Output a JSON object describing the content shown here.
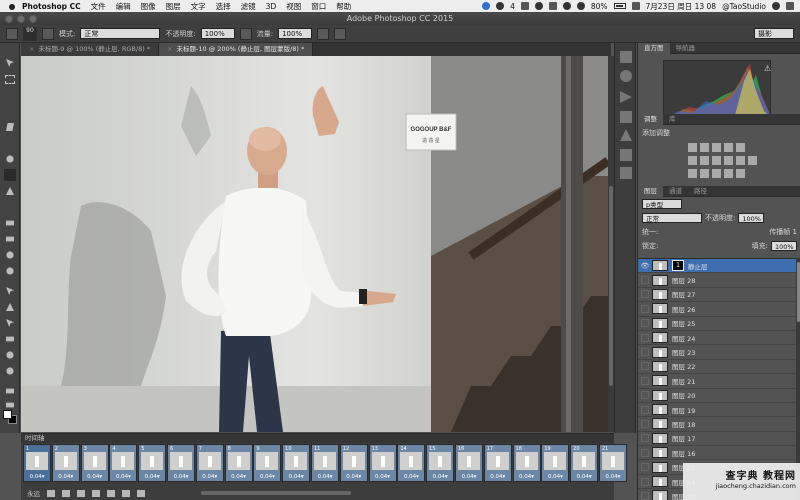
{
  "menubar": {
    "app": "Photoshop CC",
    "items": [
      "文件",
      "编辑",
      "图像",
      "图层",
      "文字",
      "选择",
      "滤镜",
      "3D",
      "视图",
      "窗口",
      "帮助"
    ],
    "wechat_badge": "4",
    "battery": "80%",
    "datetime": "7月23日 周日 13 08",
    "user": "@TaoStudio"
  },
  "window": {
    "title": "Adobe Photoshop CC 2015"
  },
  "options": {
    "brush_size": "90",
    "mode_label": "模式:",
    "mode_value": "正常",
    "opacity_label": "不透明度:",
    "opacity_value": "100%",
    "flow_label": "流量:",
    "flow_value": "100%",
    "workspace": "摄影"
  },
  "doc_tabs": [
    {
      "label": "未标题-9 @ 100% (静止层, RGB/8) *"
    },
    {
      "label": "未标题-10 @ 200% (静止层, 图层蒙版/8) *"
    }
  ],
  "canvas_sign": {
    "line1": "GOGOUP B&F",
    "line2": "造 造 星"
  },
  "histogram": {
    "tabs": [
      "直方图",
      "导航器"
    ],
    "warning": "⚠"
  },
  "adjustments": {
    "tabs": [
      "调整",
      "库"
    ],
    "add_label": "添加调整"
  },
  "layers": {
    "tabs": [
      "图层",
      "通道",
      "路径"
    ],
    "filter": "p类型",
    "blend_mode": "正常",
    "opacity_label": "不透明度:",
    "opacity_value": "100%",
    "unify_label": "统一:",
    "propagate_label": "传播帧 1",
    "lock_label": "锁定:",
    "fill_label": "填充:",
    "fill_value": "100%",
    "list": [
      "静止层",
      "图层 28",
      "图层 27",
      "图层 26",
      "图层 25",
      "图层 24",
      "图层 23",
      "图层 22",
      "图层 21",
      "图层 20",
      "图层 19",
      "图层 18",
      "图层 17",
      "图层 16",
      "图层 15",
      "图层 14",
      "图层 13"
    ]
  },
  "timeline": {
    "title": "时间轴",
    "loop": "永远",
    "frames": [
      {
        "n": "1",
        "d": "0.04▾"
      },
      {
        "n": "2",
        "d": "0.04▾"
      },
      {
        "n": "3",
        "d": "0.04▾"
      },
      {
        "n": "4",
        "d": "0.04▾"
      },
      {
        "n": "5",
        "d": "0.04▾"
      },
      {
        "n": "6",
        "d": "0.04▾"
      },
      {
        "n": "7",
        "d": "0.04▾"
      },
      {
        "n": "8",
        "d": "0.04▾"
      },
      {
        "n": "9",
        "d": "0.04▾"
      },
      {
        "n": "10",
        "d": "0.04▾"
      },
      {
        "n": "11",
        "d": "0.04▾"
      },
      {
        "n": "12",
        "d": "0.04▾"
      },
      {
        "n": "13",
        "d": "0.04▾"
      },
      {
        "n": "14",
        "d": "0.04▾"
      },
      {
        "n": "15",
        "d": "0.04▾"
      },
      {
        "n": "16",
        "d": "0.04▾"
      },
      {
        "n": "17",
        "d": "0.04▾"
      },
      {
        "n": "18",
        "d": "0.04▾"
      },
      {
        "n": "19",
        "d": "0.04▾"
      },
      {
        "n": "20",
        "d": "0.04▾"
      },
      {
        "n": "21",
        "d": "0.04▾"
      }
    ]
  },
  "watermark": {
    "main": "查字典 教程网",
    "sub": "jiaocheng.chazidian.com"
  }
}
